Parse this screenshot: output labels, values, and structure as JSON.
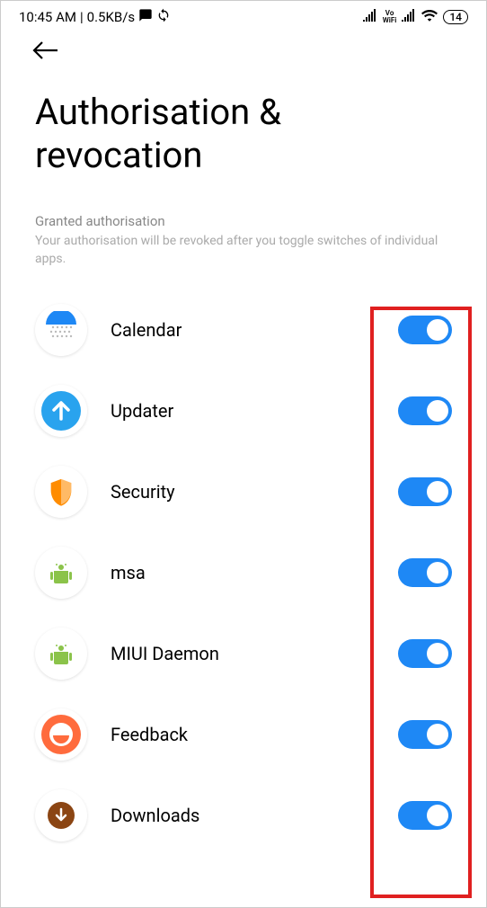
{
  "status_bar": {
    "time": "10:45 AM",
    "data_rate": "0.5KB/s",
    "battery": "14"
  },
  "page": {
    "title": "Authorisation & revocation"
  },
  "section": {
    "title": "Granted authorisation",
    "description": "Your authorisation will be revoked after you toggle switches of individual apps."
  },
  "apps": [
    {
      "name": "Calendar",
      "icon": "calendar-icon",
      "enabled": true
    },
    {
      "name": "Updater",
      "icon": "updater-icon",
      "enabled": true
    },
    {
      "name": "Security",
      "icon": "security-icon",
      "enabled": true
    },
    {
      "name": "msa",
      "icon": "msa-icon",
      "enabled": true
    },
    {
      "name": "MIUI Daemon",
      "icon": "miui-daemon-icon",
      "enabled": true
    },
    {
      "name": "Feedback",
      "icon": "feedback-icon",
      "enabled": true
    },
    {
      "name": "Downloads",
      "icon": "downloads-icon",
      "enabled": true
    }
  ]
}
